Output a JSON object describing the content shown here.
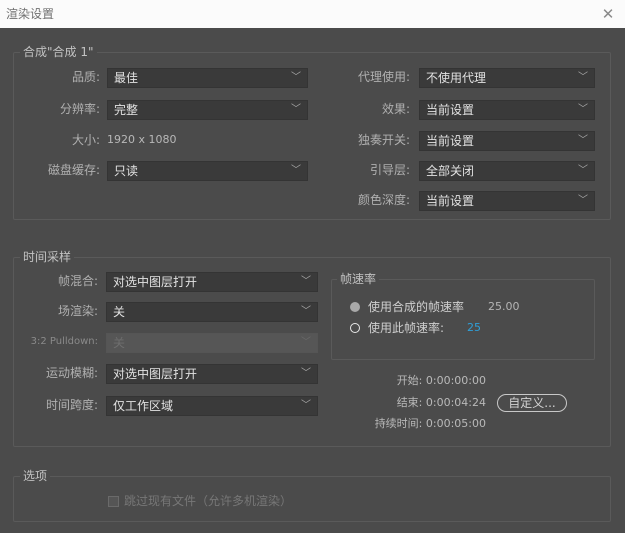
{
  "window": {
    "title": "渲染设置"
  },
  "comp_group": {
    "title": "合成\"合成 1\"",
    "quality": {
      "label": "品质:",
      "value": "最佳"
    },
    "resolution": {
      "label": "分辨率:",
      "value": "完整"
    },
    "size": {
      "label": "大小:",
      "value": "1920 x 1080"
    },
    "disk_cache": {
      "label": "磁盘缓存:",
      "value": "只读"
    },
    "proxy": {
      "label": "代理使用:",
      "value": "不使用代理"
    },
    "effects": {
      "label": "效果:",
      "value": "当前设置"
    },
    "solo": {
      "label": "独奏开关:",
      "value": "当前设置"
    },
    "guide": {
      "label": "引导层:",
      "value": "全部关闭"
    },
    "color_depth": {
      "label": "颜色深度:",
      "value": "当前设置"
    }
  },
  "time_group": {
    "title": "时间采样",
    "frame_blend": {
      "label": "帧混合:",
      "value": "对选中图层打开"
    },
    "field_render": {
      "label": "场渲染:",
      "value": "关"
    },
    "pulldown": {
      "label": "3:2 Pulldown:",
      "value": "关"
    },
    "motion_blur": {
      "label": "运动模糊:",
      "value": "对选中图层打开"
    },
    "time_span": {
      "label": "时间跨度:",
      "value": "仅工作区域"
    },
    "frame_rate": {
      "title": "帧速率",
      "use_comp": {
        "label": "使用合成的帧速率",
        "value": "25.00",
        "selected": false
      },
      "use_this": {
        "label": "使用此帧速率:",
        "value": "25",
        "selected": true
      }
    },
    "start": "开始: 0:00:00:00",
    "end": "结束: 0:00:04:24",
    "duration": "持续时间: 0:00:05:00",
    "custom_button": "自定义..."
  },
  "options_group": {
    "title": "选项",
    "skip_existing": {
      "label": "跳过现有文件（允许多机渲染）",
      "checked": false
    }
  },
  "colors": {
    "panel_bg": "#4b4b4b",
    "dropdown_bg": "#3a3a3a",
    "accent_blue": "#2f9fd8"
  }
}
